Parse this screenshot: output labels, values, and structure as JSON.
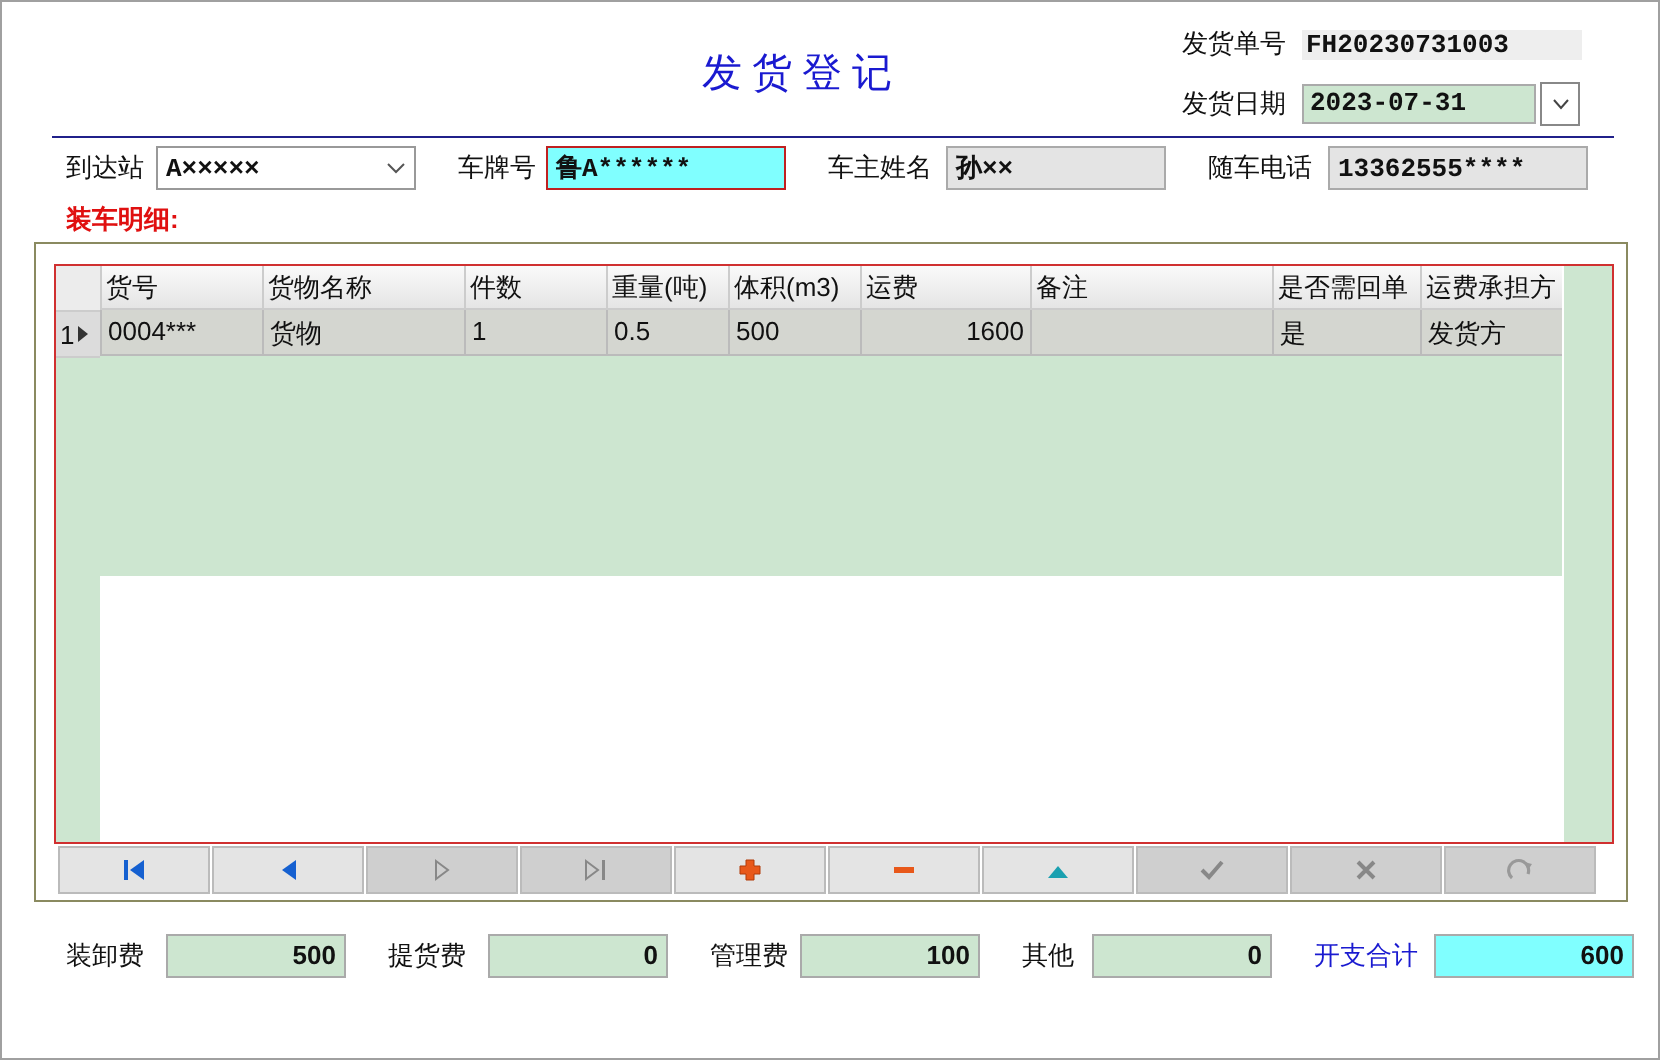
{
  "title": "发货登记",
  "order_no": {
    "label": "发货单号",
    "value": "FH20230731003"
  },
  "ship_date": {
    "label": "发货日期",
    "value": "2023-07-31"
  },
  "fields": [
    {
      "label": "到达站",
      "value": "A×××××",
      "kind": "combo"
    },
    {
      "label": "车牌号",
      "value": "鲁A******",
      "kind": "highlight"
    },
    {
      "label": "车主姓名",
      "value": "孙××",
      "kind": "readonly"
    },
    {
      "label": "随车电话",
      "value": "13362555****",
      "kind": "readonly"
    }
  ],
  "section_title": "装车明细:",
  "table": {
    "columns": [
      {
        "label": "货号"
      },
      {
        "label": "货物名称"
      },
      {
        "label": "件数"
      },
      {
        "label": "重量(吨)"
      },
      {
        "label": "体积(m3)"
      },
      {
        "label": "运费"
      },
      {
        "label": "备注"
      },
      {
        "label": "是否需回单"
      },
      {
        "label": "运费承担方"
      }
    ],
    "rows": [
      {
        "number": "1",
        "selected": true,
        "cells": [
          "0004***",
          "货物",
          "1",
          "0.5",
          "500",
          "1600",
          "",
          "是",
          "发货方"
        ]
      }
    ]
  },
  "nav_buttons": [
    {
      "kind": "first",
      "disabled": false
    },
    {
      "kind": "prev",
      "disabled": false
    },
    {
      "kind": "next",
      "disabled": true
    },
    {
      "kind": "last",
      "disabled": true
    },
    {
      "kind": "add",
      "disabled": false
    },
    {
      "kind": "delete",
      "disabled": false
    },
    {
      "kind": "up",
      "disabled": false
    },
    {
      "kind": "confirm",
      "disabled": true
    },
    {
      "kind": "cancel",
      "disabled": true
    },
    {
      "kind": "refresh",
      "disabled": true
    }
  ],
  "costs": [
    {
      "label": "装卸费",
      "value": "500",
      "kind": "item"
    },
    {
      "label": "提货费",
      "value": "0",
      "kind": "item"
    },
    {
      "label": "管理费",
      "value": "100",
      "kind": "item"
    },
    {
      "label": "其他",
      "value": "0",
      "kind": "item"
    },
    {
      "label": "开支合计",
      "value": "600",
      "kind": "total"
    }
  ]
}
